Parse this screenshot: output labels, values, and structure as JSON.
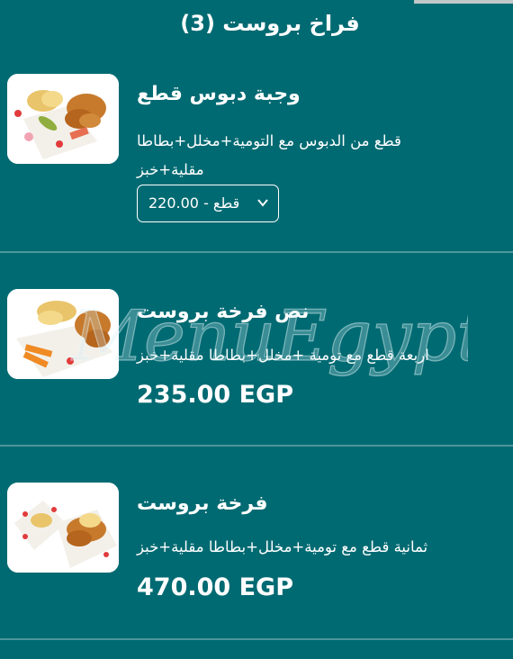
{
  "section": {
    "title": "فراخ بروست (3)"
  },
  "items": [
    {
      "name": "وجبة دبوس قطع",
      "desc_line1": "قطع من الدبوس مع التومية+مخلل+بطاطا",
      "desc_line2": "مقلية+خبز",
      "select_value": "قطع - 220.00",
      "image_icon": "fried-chicken-plate-icon"
    },
    {
      "name": "نص فرخة بروست",
      "desc_line1": "اربعة قطع مع تومية +مخلل+بطاطا مقلية+خبز",
      "price": "235.00 EGP",
      "image_icon": "fried-chicken-plate-icon"
    },
    {
      "name": "فرخة بروست",
      "desc_line1": "ثمانية قطع مع تومية+مخلل+بطاطا مقلية+خبز",
      "price": "470.00 EGP",
      "image_icon": "fried-chicken-plate-icon"
    }
  ],
  "watermark": {
    "text": "MenuEgypt.com"
  },
  "colors": {
    "background": "#006a72",
    "divider": "#4c979d",
    "text": "#ffffff"
  }
}
